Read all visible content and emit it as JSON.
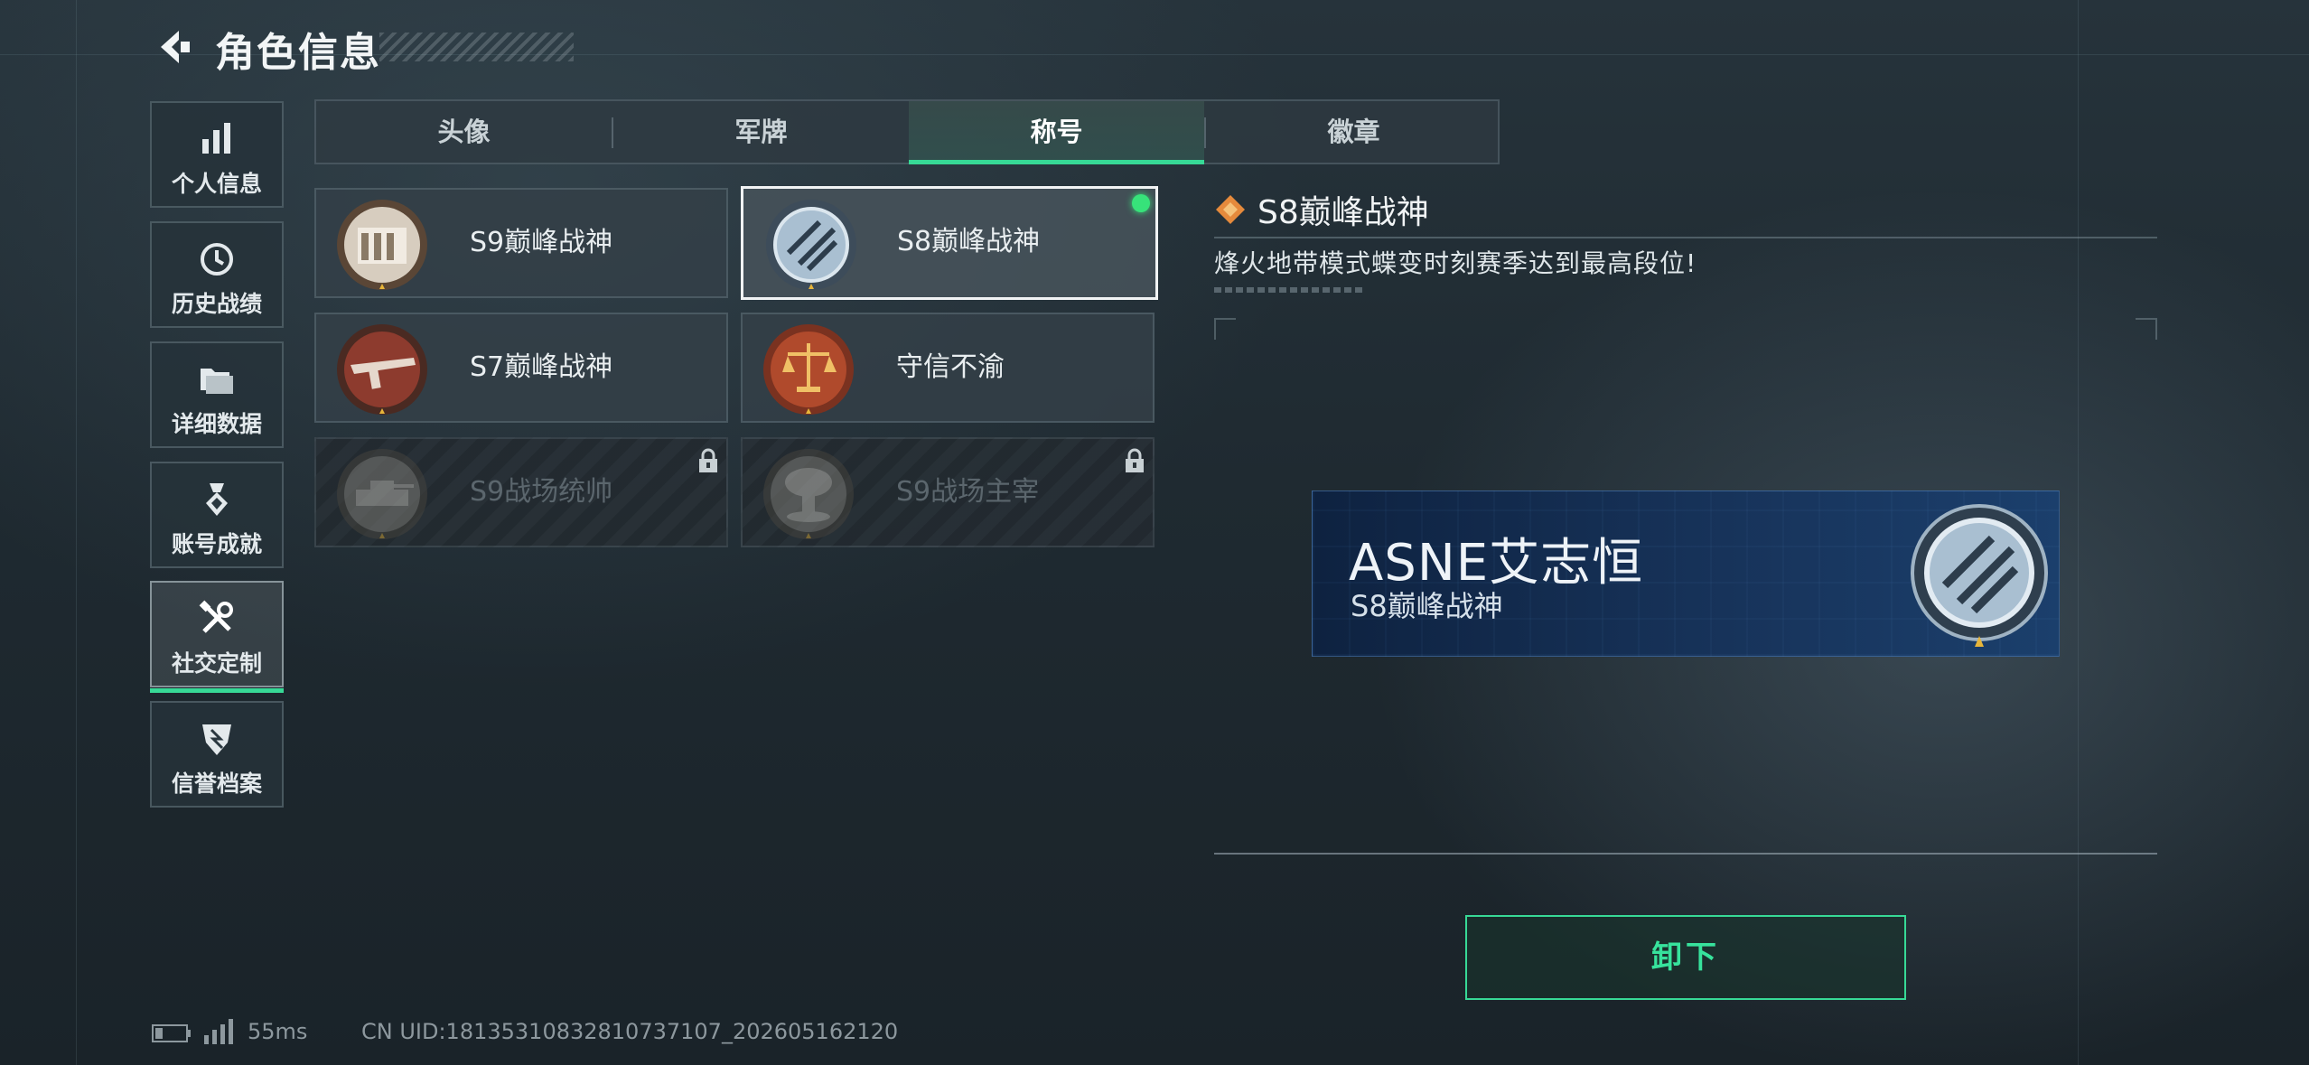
{
  "header": {
    "title": "角色信息"
  },
  "sidebar": {
    "items": [
      {
        "label": "个人信息",
        "icon": "bar-chart-icon"
      },
      {
        "label": "历史战绩",
        "icon": "history-clock-icon"
      },
      {
        "label": "详细数据",
        "icon": "folder-icon"
      },
      {
        "label": "账号成就",
        "icon": "medal-icon"
      },
      {
        "label": "社交定制",
        "icon": "tools-icon",
        "active": true
      },
      {
        "label": "信誉档案",
        "icon": "shield-badge-icon"
      }
    ]
  },
  "tabs": [
    {
      "label": "头像"
    },
    {
      "label": "军牌"
    },
    {
      "label": "称号",
      "active": true
    },
    {
      "label": "徽章"
    }
  ],
  "titles": [
    {
      "name": "S9巅峰战神",
      "emblem": "building-emblem-icon",
      "locked": false,
      "selected": false
    },
    {
      "name": "S8巅峰战神",
      "emblem": "blue-crest-emblem-icon",
      "locked": false,
      "selected": true,
      "equipped": true
    },
    {
      "name": "S7巅峰战神",
      "emblem": "rifle-emblem-icon",
      "locked": false,
      "selected": false
    },
    {
      "name": "守信不渝",
      "emblem": "scales-emblem-icon",
      "locked": false,
      "selected": false
    },
    {
      "name": "S9战场统帅",
      "emblem": "tank-emblem-icon",
      "locked": true,
      "selected": false
    },
    {
      "name": "S9战场主宰",
      "emblem": "mushroom-cloud-emblem-icon",
      "locked": true,
      "selected": false
    }
  ],
  "detail": {
    "title": "S8巅峰战神",
    "description": "烽火地带模式蝶变时刻赛季达到最高段位!"
  },
  "preview": {
    "player_name": "ASNE艾志恒",
    "title": "S8巅峰战神"
  },
  "actions": {
    "unequip_label": "卸下"
  },
  "status": {
    "ping": "55ms",
    "uid": "CN UID:18135310832810737107_202605162120"
  },
  "colors": {
    "accent": "#37d996",
    "equipped_dot": "#37e27a",
    "nameplate": "#17335a"
  }
}
